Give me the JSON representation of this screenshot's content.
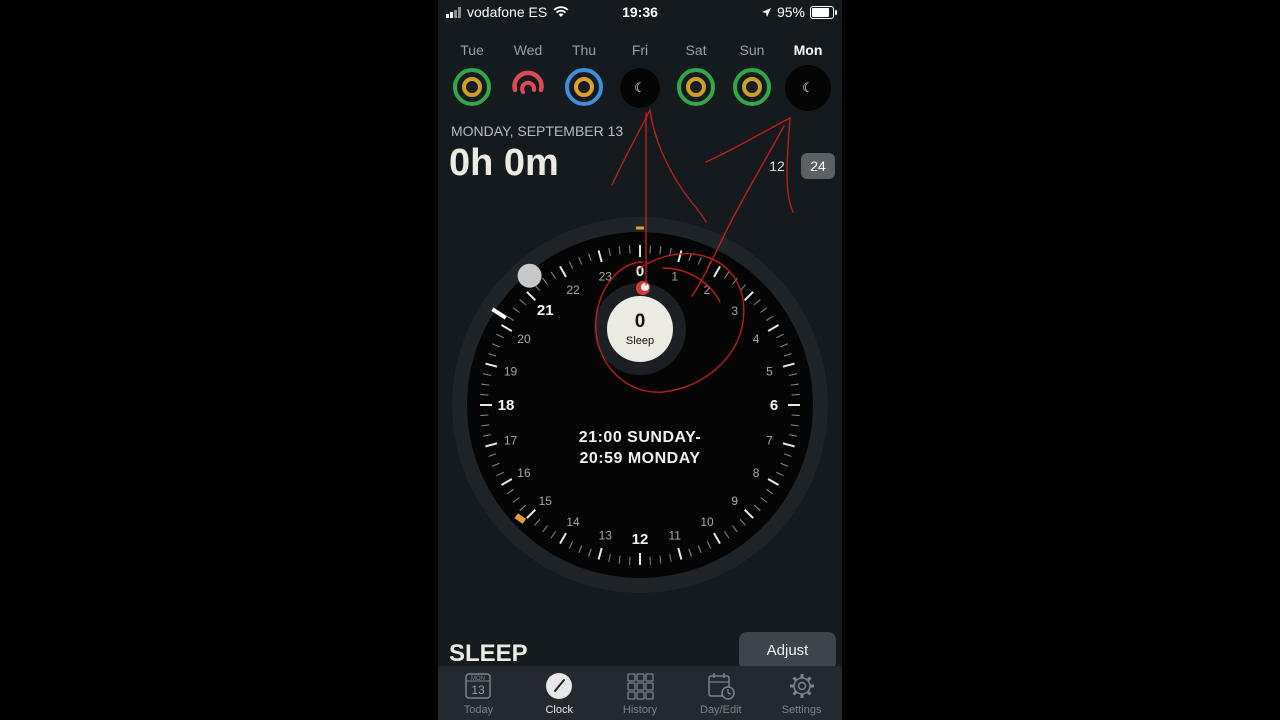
{
  "status_bar": {
    "carrier": "vodafone ES",
    "time": "19:36",
    "battery": "95%",
    "battery_level": 0.95
  },
  "days": [
    {
      "label": "Tue",
      "type": "ring",
      "outer_color": "#2fa84a",
      "inner_color": "#c9a227"
    },
    {
      "label": "Wed",
      "type": "partial",
      "outer_color": "#e04a58",
      "inner_color": "#e04a58"
    },
    {
      "label": "Thu",
      "type": "ring",
      "outer_color": "#3b8ee0",
      "inner_color": "#e0a030"
    },
    {
      "label": "Fri",
      "type": "night",
      "icon": "moon-icon"
    },
    {
      "label": "Sat",
      "type": "ring",
      "outer_color": "#2fa84a",
      "inner_color": "#c9a227"
    },
    {
      "label": "Sun",
      "type": "ring",
      "outer_color": "#2fa84a",
      "inner_color": "#c9a227"
    },
    {
      "label": "Mon",
      "type": "night",
      "icon": "moon-icon",
      "selected": true
    }
  ],
  "header": {
    "date": "MONDAY, SEPTEMBER 13",
    "duration": "0h 0m",
    "format_12": "12",
    "format_24": "24",
    "format_selected": "24"
  },
  "dial": {
    "hour_labels": [
      "0",
      "1",
      "2",
      "3",
      "4",
      "5",
      "6",
      "7",
      "8",
      "9",
      "10",
      "11",
      "12",
      "13",
      "14",
      "15",
      "16",
      "17",
      "18",
      "19",
      "20",
      "21",
      "22",
      "23"
    ],
    "bold_hours": [
      "0",
      "6",
      "12",
      "18",
      "21"
    ],
    "center_value": "0",
    "center_label": "Sleep",
    "range_line1": "21:00 SUNDAY-",
    "range_line2": "20:59 MONDAY",
    "handle_hour": 21.3,
    "accent_color": "#e0a030"
  },
  "section_title": "SLEEP",
  "adjust_label": "Adjust",
  "tabs": [
    {
      "label": "Today",
      "icon": "calendar-icon",
      "cal_month": "MON",
      "cal_day": "13"
    },
    {
      "label": "Clock",
      "icon": "clock-icon",
      "active": true
    },
    {
      "label": "History",
      "icon": "grid-icon"
    },
    {
      "label": "Day/Edit",
      "icon": "calendar-edit-icon"
    },
    {
      "label": "Settings",
      "icon": "gear-icon"
    }
  ]
}
